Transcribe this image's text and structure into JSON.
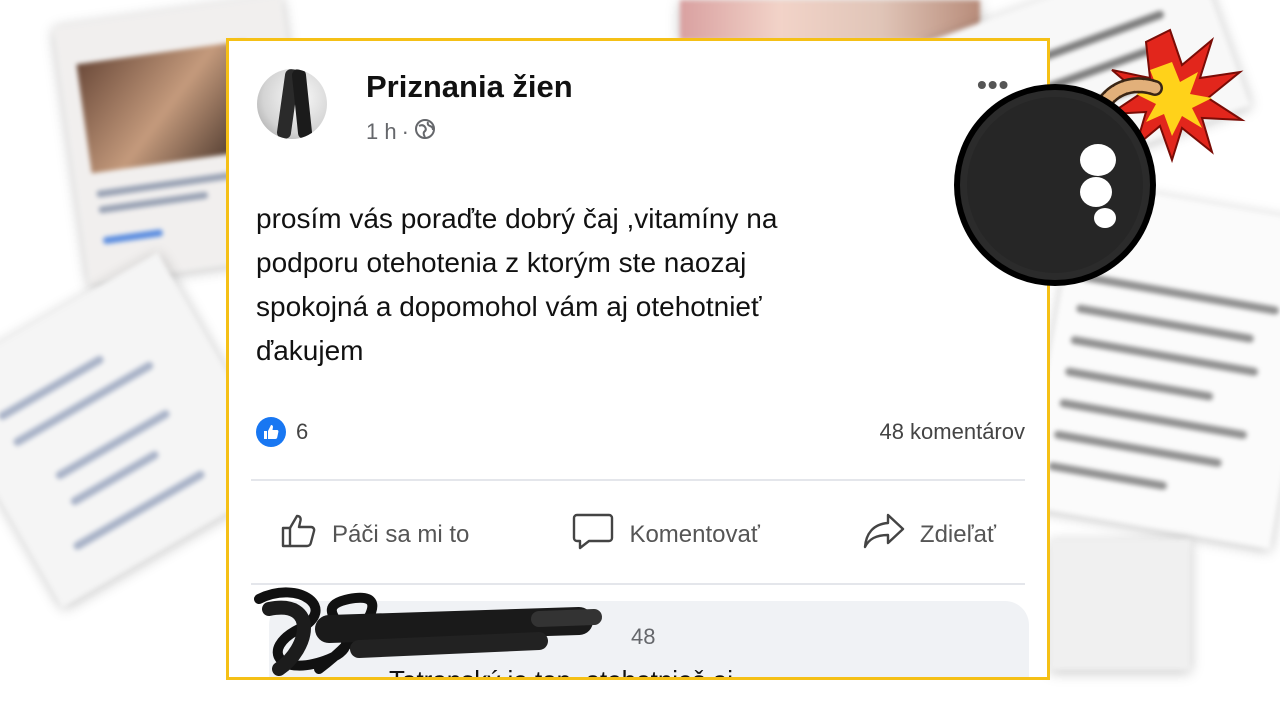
{
  "post": {
    "page_name": "Priznania žien",
    "time": "1 h",
    "separator": "·",
    "body": "prosím vás poraďte dobrý čaj ,vitamíny na\npodporu otehotenia z ktorým ste naozaj\nspokojná a dopomohol vám aj otehotnieť\nďakujem",
    "reaction_count": "6",
    "comments_count": "48 komentárov",
    "actions": {
      "like": "Páči sa mi to",
      "comment": "Komentovať",
      "share": "Zdieľať"
    }
  },
  "comment": {
    "time": "48",
    "text": "Tatranský je top, otehotnieš aj"
  },
  "colors": {
    "frame": "#f5c016",
    "like_blue": "#1877f2",
    "meta_gray": "#65676b"
  },
  "icons": [
    "globe-icon",
    "more-icon",
    "like-reaction-icon",
    "thumbs-up-icon",
    "comment-icon",
    "share-icon",
    "bomb-icon"
  ]
}
